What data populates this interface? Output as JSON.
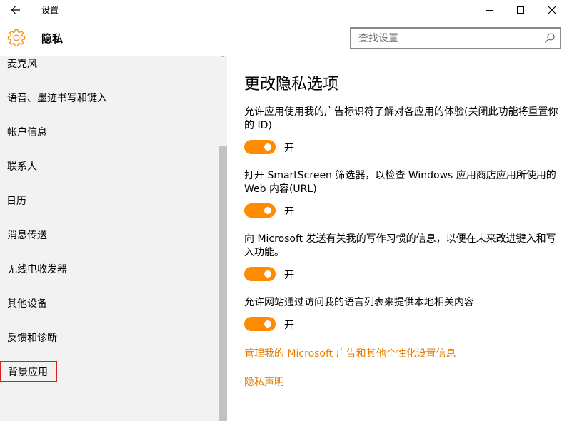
{
  "colors": {
    "accent": "#ff8c00",
    "link": "#e57f00",
    "sidebar_bg": "#f2f2f2",
    "highlight_border": "#d81e1e"
  },
  "titlebar": {
    "title": "设置",
    "back_icon": "back-arrow-icon",
    "minimize_icon": "minimize-icon",
    "maximize_icon": "maximize-icon",
    "close_icon": "close-icon"
  },
  "header": {
    "page_title": "隐私",
    "icon": "gear-icon",
    "search": {
      "placeholder": "查找设置",
      "value": "",
      "icon": "search-icon"
    }
  },
  "sidebar": {
    "items": [
      {
        "label": "麦克风"
      },
      {
        "label": "语音、墨迹书写和键入"
      },
      {
        "label": "帐户信息"
      },
      {
        "label": "联系人"
      },
      {
        "label": "日历"
      },
      {
        "label": "消息传送"
      },
      {
        "label": "无线电收发器"
      },
      {
        "label": "其他设备"
      },
      {
        "label": "反馈和诊断"
      },
      {
        "label": "背景应用"
      }
    ]
  },
  "main": {
    "heading": "更改隐私选项",
    "settings": [
      {
        "description": "允许应用使用我的广告标识符了解对各应用的体验(关闭此功能将重置你的 ID)",
        "state": "开",
        "on": true
      },
      {
        "description": "打开 SmartScreen 筛选器，以检查 Windows 应用商店应用所使用的 Web 内容(URL)",
        "state": "开",
        "on": true
      },
      {
        "description": "向 Microsoft 发送有关我的写作习惯的信息，以便在未来改进键入和写入功能。",
        "state": "开",
        "on": true
      },
      {
        "description": "允许网站通过访问我的语言列表来提供本地相关内容",
        "state": "开",
        "on": true
      }
    ],
    "links": [
      {
        "label": "管理我的 Microsoft 广告和其他个性化设置信息"
      },
      {
        "label": "隐私声明"
      }
    ]
  }
}
